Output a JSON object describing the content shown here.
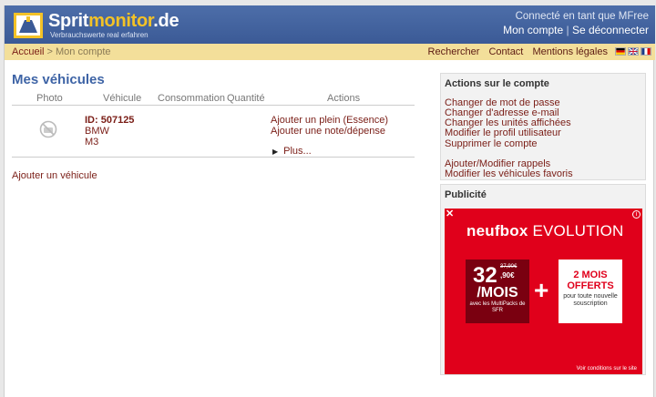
{
  "header": {
    "logo_part1": "Sprit",
    "logo_part2": "monitor",
    "logo_part3": ".de",
    "tagline": "Verbrauchswerte real erfahren",
    "connected_as": "Connecté en tant que MFree",
    "my_account": "Mon compte",
    "separator": "|",
    "logout": "Se déconnecter"
  },
  "navbar": {
    "breadcrumb_home": "Accueil",
    "breadcrumb_rest": " > Mon compte",
    "links": [
      "Rechercher",
      "Contact",
      "Mentions légales"
    ],
    "flags": [
      "flag-de-icon",
      "flag-uk-icon",
      "flag-fr-icon"
    ]
  },
  "main": {
    "title": "Mes véhicules",
    "columns": [
      "Photo",
      "Véhicule",
      "Consommation",
      "Quantité",
      "Actions"
    ],
    "vehicle": {
      "id": "ID: 507125",
      "brand": "BMW",
      "model": "M3"
    },
    "actions": [
      "Ajouter un plein (Essence)",
      "Ajouter une note/dépense",
      "Plus..."
    ],
    "add_vehicle": "Ajouter un véhicule"
  },
  "sidebar": {
    "account_title": "Actions sur le compte",
    "account_links": [
      "Changer de mot de passe",
      "Changer d'adresse e-mail",
      "Changer les unités affichées",
      "Modifier le profil utilisateur",
      "Supprimer le compte",
      "Ajouter/Modifier rappels",
      "Modifier les véhicules favoris"
    ],
    "pub_title": "Publicité"
  },
  "ad": {
    "close": "✕",
    "info": "i",
    "brand_bold": "neufbox",
    "brand_rest": " EVOLUTION",
    "price_big": "32",
    "price_old": "37,90€",
    "price_cents": ",90€",
    "price_unit": "/MOIS",
    "price_note": "avec les MultiPacks de SFR",
    "plus": "+",
    "offer_title": "2 MOIS OFFERTS",
    "offer_text": "pour toute nouvelle souscription",
    "conditions": "Voir conditions sur le site"
  },
  "colors": {
    "header_blue": "#3b5a96",
    "nav_yellow": "#f3df9a",
    "link_red": "#7a1d16",
    "title_blue": "#3e64a6",
    "ad_red": "#e0001b"
  }
}
